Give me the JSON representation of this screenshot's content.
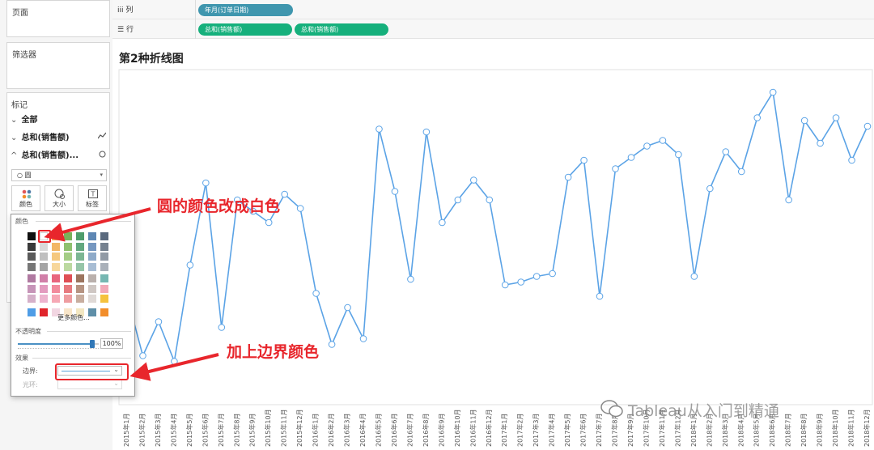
{
  "sidebar": {
    "pages_label": "页面",
    "filters_label": "筛选器",
    "marks_label": "标记",
    "marks_rows": [
      {
        "label": "全部",
        "chevron": "⌄",
        "icon": ""
      },
      {
        "label": "总和(销售额)",
        "chevron": "⌄",
        "icon": "line-icon"
      },
      {
        "label": "总和(销售额)...",
        "chevron": "^",
        "icon": "circle-icon"
      }
    ],
    "mark_type": "圆",
    "buttons": [
      "颜色",
      "大小",
      "标签"
    ]
  },
  "shelves": {
    "columns_label": "列",
    "rows_label": "行",
    "columns_pill": "年月(订单日期)",
    "rows_pills": [
      "总和(销售额)",
      "总和(销售额)"
    ]
  },
  "sheet": {
    "title": "第2种折线图"
  },
  "color_popup": {
    "color_label": "颜色",
    "more_colors": "更多颜色...",
    "opacity_label": "不透明度",
    "opacity_value": "100%",
    "opacity_fraction": 0.92,
    "effects_label": "效果",
    "border_label": "边界:",
    "halo_label": "光环:",
    "palette": [
      [
        "#111111",
        "#ffffff",
        "#f5a94c",
        "#79b25a",
        "#4e9d6c",
        "#5e87b4",
        "#5a6a7e"
      ],
      [
        "#3a3a3a",
        "#d9d9d9",
        "#f2b766",
        "#8fc16f",
        "#63a87f",
        "#7597c0",
        "#75818f"
      ],
      [
        "#5a5a5a",
        "#bfbfbf",
        "#f5c87e",
        "#a4cd86",
        "#7cb693",
        "#8eaac9",
        "#919aa5"
      ],
      [
        "#777777",
        "#a5a5a5",
        "#f7d79c",
        "#bcd9a1",
        "#96c5a8",
        "#a8bdd4",
        "#aab1ba"
      ],
      [
        "#b07aa1",
        "#d17fa8",
        "#e8667d",
        "#df4f55",
        "#9c755f",
        "#bab0ac",
        "#76b7b2"
      ],
      [
        "#c694b8",
        "#e39bbf",
        "#f28b9c",
        "#e77a7f",
        "#b69482",
        "#cfc7c3",
        "#f2a9b8"
      ],
      [
        "#d5b0c9",
        "#edb4cf",
        "#f6a8b5",
        "#ee9da0",
        "#c8ae9f",
        "#dfd9d6",
        "#f5c23e"
      ],
      [
        "#4f9de6",
        "#e0252b",
        "#f2d6e2",
        "#f8e6c9",
        "#f3e7c1",
        "#5f8fa8",
        "#f28e2b"
      ]
    ]
  },
  "annotations": {
    "white_color": "圆的颜色改成白色",
    "border_color": "加上边界颜色"
  },
  "chart_data": {
    "type": "line",
    "title": "第2种折线图",
    "xlabel": "",
    "ylabel": "",
    "categories": [
      "2015年1月",
      "2015年2月",
      "2015年3月",
      "2015年4月",
      "2015年5月",
      "2015年6月",
      "2015年7月",
      "2015年8月",
      "2015年9月",
      "2015年10月",
      "2015年11月",
      "2015年12月",
      "2016年1月",
      "2016年2月",
      "2016年3月",
      "2016年4月",
      "2016年5月",
      "2016年6月",
      "2016年7月",
      "2016年8月",
      "2016年9月",
      "2016年10月",
      "2016年11月",
      "2016年12月",
      "2017年1月",
      "2017年2月",
      "2017年3月",
      "2017年4月",
      "2017年5月",
      "2017年6月",
      "2017年7月",
      "2017年8月",
      "2017年9月",
      "2017年10月",
      "2017年11月",
      "2017年12月",
      "2018年1月",
      "2018年2月",
      "2018年3月",
      "2018年4月",
      "2018年5月",
      "2018年6月",
      "2018年7月",
      "2018年8月",
      "2018年9月",
      "2018年10月",
      "2018年11月",
      "2018年12月"
    ],
    "values": [
      0.24,
      0.03,
      0.15,
      0.01,
      0.35,
      0.64,
      0.13,
      0.58,
      0.54,
      0.5,
      0.6,
      0.55,
      0.25,
      0.07,
      0.2,
      0.09,
      0.83,
      0.61,
      0.3,
      0.82,
      0.5,
      0.58,
      0.65,
      0.58,
      0.28,
      0.29,
      0.31,
      0.32,
      0.66,
      0.72,
      0.24,
      0.69,
      0.73,
      0.77,
      0.79,
      0.74,
      0.31,
      0.62,
      0.75,
      0.68,
      0.87,
      0.96,
      0.58,
      0.86,
      0.78,
      0.87,
      0.72,
      0.84
    ],
    "marker": "circle",
    "marker_fill": "#ffffff",
    "line_color": "#5ba3e6",
    "grid": false,
    "legend": "none"
  },
  "watermark": "Tableau从入门到精通"
}
